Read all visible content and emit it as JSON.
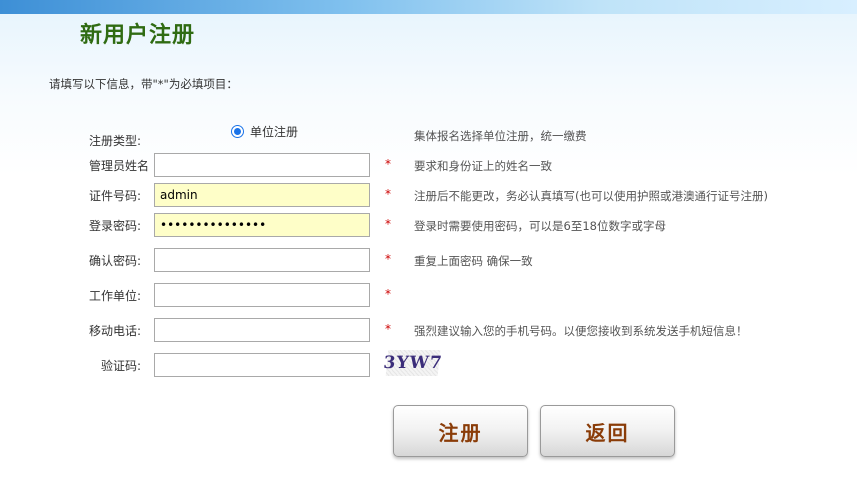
{
  "header": {
    "title": "新用户注册"
  },
  "hint": "请填写以下信息，带\"*\"为必填项目：",
  "form": {
    "reg_type": {
      "label": "注册类型:",
      "option": "单位注册",
      "note": "集体报名选择单位注册，统一缴费"
    },
    "admin_name": {
      "label": "管理员姓名",
      "value": "",
      "star": "*",
      "note": "要求和身份证上的姓名一致"
    },
    "id_number": {
      "label": "证件号码:",
      "value": "admin",
      "star": "*",
      "note": "注册后不能更改，务必认真填写(也可以使用护照或港澳通行证号注册)"
    },
    "password": {
      "label": "登录密码:",
      "value": "•••••••••••••••",
      "star": "*",
      "note": "登录时需要使用密码，可以是6至18位数字或字母"
    },
    "confirm_password": {
      "label": "确认密码:",
      "value": "",
      "star": "*",
      "note": "重复上面密码 确保一致"
    },
    "work_unit": {
      "label": "工作单位:",
      "value": "",
      "star": "*"
    },
    "mobile": {
      "label": "移动电话:",
      "value": "",
      "star": "*",
      "note": "强烈建议输入您的手机号码。以便您接收到系统发送手机短信息！"
    },
    "captcha": {
      "label": "验证码:",
      "value": "",
      "image_text": "3YW7"
    }
  },
  "buttons": {
    "submit": "注册",
    "back": "返回"
  },
  "colors": {
    "title": "#2f6b12",
    "button_text": "#8a3c08",
    "required_star": "#cc0000",
    "autofill_bg": "#fefec8"
  }
}
